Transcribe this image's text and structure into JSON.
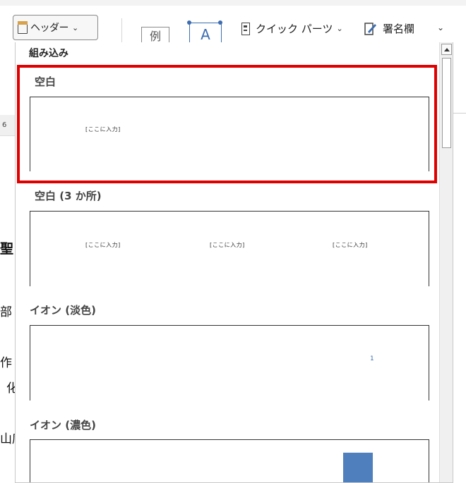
{
  "ribbon": {
    "header_label": "ヘッダー",
    "example_label": "例",
    "textbox_label": "A",
    "quick_parts_label": "クイック パーツ",
    "signature_label": "署名欄"
  },
  "doc": {
    "ruler_text": "6",
    "fragments": [
      "聖|",
      "部",
      "作",
      "化",
      "山席"
    ]
  },
  "gallery": {
    "section": "組み込み",
    "items": [
      {
        "title": "空白",
        "placeholders": [
          "[ここに入力]"
        ]
      },
      {
        "title": "空白 (3 か所)",
        "placeholders": [
          "[ここに入力]",
          "[ここに入力]",
          "[ここに入力]"
        ]
      },
      {
        "title": "イオン (淡色)",
        "page_number": "1"
      },
      {
        "title": "イオン (濃色)"
      }
    ]
  },
  "colors": {
    "selection": "#e00000",
    "accent": "#3c6db0",
    "block": "#4f80bd"
  }
}
